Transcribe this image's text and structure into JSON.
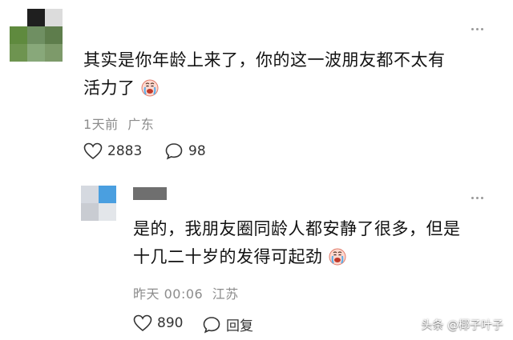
{
  "comments": [
    {
      "text_line1": "其实是你年龄上来了，你的这一波朋友都不太有",
      "text_line2": "活力了",
      "emoji": "crying-emoji",
      "time": "1天前",
      "location": "广东",
      "likes": "2883",
      "replies": "98"
    },
    {
      "text_line1": "是的，我朋友圈同龄人都安静了很多，但是",
      "text_line2": "十几二十岁的发得可起劲",
      "emoji": "crying-emoji",
      "time": "昨天 00:06",
      "location": "江苏",
      "likes": "890",
      "reply_label": "回复"
    }
  ],
  "watermark": "头条 @椰子叶子",
  "icons": {
    "like": "heart-outline-icon",
    "comment": "speech-bubble-icon",
    "more": "more-dots-icon"
  }
}
